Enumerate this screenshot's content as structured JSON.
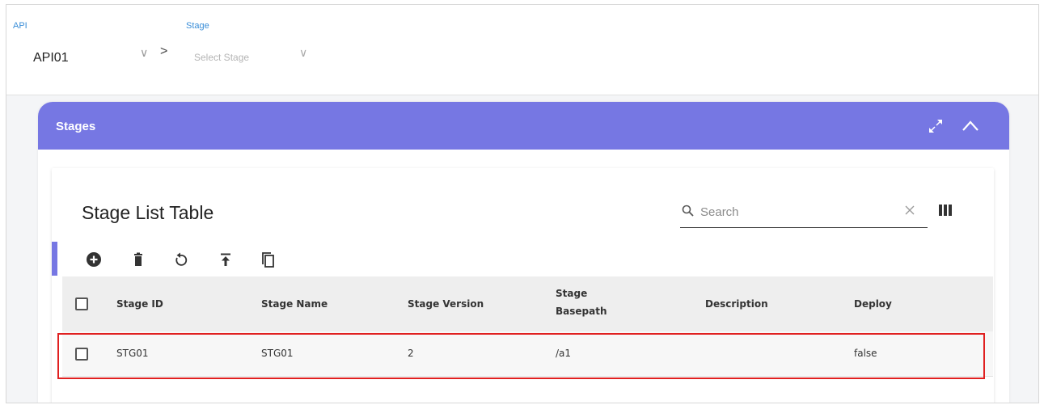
{
  "selector": {
    "api_label": "API",
    "api_value": "API01",
    "stage_label": "Stage",
    "stage_placeholder": "Select Stage",
    "chevron": "∨",
    "breadcrumb_arrow": ">"
  },
  "panel": {
    "title": "Stages",
    "header_color": "#7677e3",
    "icons": [
      "expand-icon",
      "collapse-icon"
    ]
  },
  "table": {
    "title": "Stage List Table",
    "search_placeholder": "Search",
    "toolbar_icons": [
      "add-circle-icon",
      "delete-icon",
      "refresh-icon",
      "upload-icon",
      "copy-icon"
    ],
    "columns": [
      "Stage ID",
      "Stage Name",
      "Stage Version",
      "Stage",
      "Basepath",
      "Description",
      "Deploy"
    ],
    "rows": [
      {
        "stage_id": "STG01",
        "stage_name": "STG01",
        "stage_version": "2",
        "stage_basepath": "/a1",
        "description": "",
        "deploy": "false"
      }
    ]
  },
  "highlight_color": "#e02020"
}
